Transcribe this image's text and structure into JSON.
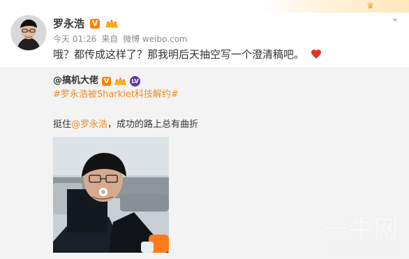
{
  "post": {
    "author": "罗永浩",
    "vip_badge": "V",
    "time": "今天 01:26",
    "source_prefix": "来自",
    "source": "微博 weibo.com",
    "text": "哦？都传成这样了？那我明后天抽空写一个澄清稿吧。"
  },
  "repost": {
    "author": "@搞机大佬",
    "vip_badge": "V",
    "level_badge": "LV",
    "hashtag": "#罗永浩被Sharklet科技解约#",
    "text_prefix": "挺住",
    "mention": "@罗永浩",
    "text_suffix": "，成功的路上总有曲折"
  },
  "watermark": {
    "main": "一牛网",
    "sub": "16RD.COM"
  },
  "icons": {
    "menu": "chevron-down-icon",
    "heart": "heart-icon",
    "crown": "crown-icon"
  },
  "colors": {
    "accent": "#ff8200",
    "link": "#f08b1f",
    "heart": "#e5332a"
  }
}
